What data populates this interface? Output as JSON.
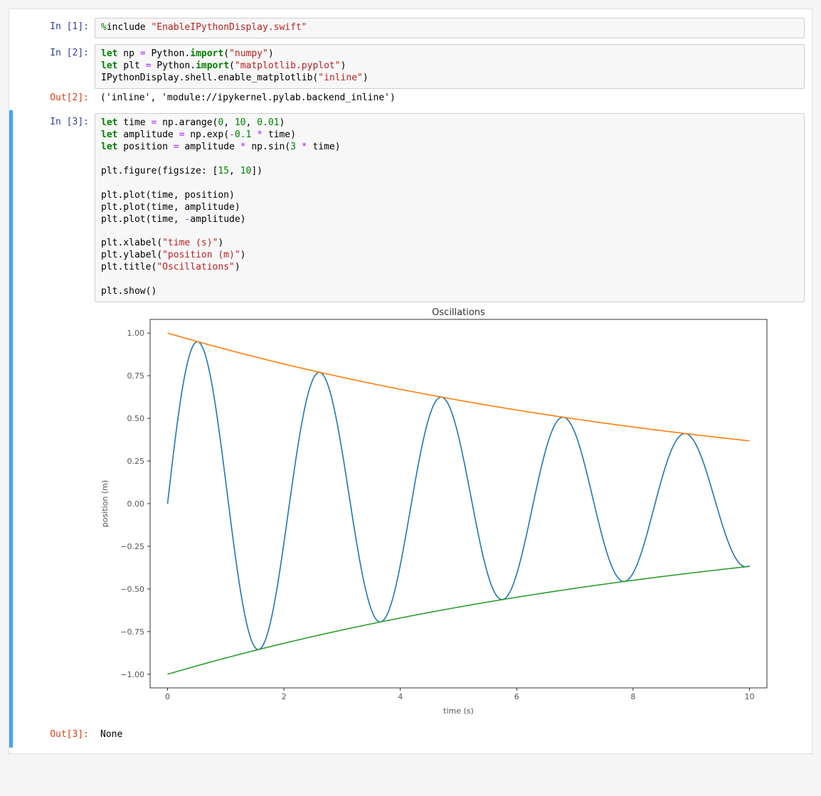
{
  "cells": [
    {
      "in_prompt": "In [1]:",
      "code_tokens": [
        [
          "mg",
          "%"
        ],
        [
          "nm",
          "include "
        ],
        [
          "str",
          "\"EnableIPythonDisplay.swift\""
        ]
      ]
    },
    {
      "in_prompt": "In [2]:",
      "code_tokens": [
        [
          "kw",
          "let"
        ],
        [
          "nm",
          " np "
        ],
        [
          "op",
          "="
        ],
        [
          "nm",
          " Python."
        ],
        [
          "kw",
          "import"
        ],
        [
          "nm",
          "("
        ],
        [
          "str",
          "\"numpy\""
        ],
        [
          "nm",
          ")\n"
        ],
        [
          "kw",
          "let"
        ],
        [
          "nm",
          " plt "
        ],
        [
          "op",
          "="
        ],
        [
          "nm",
          " Python."
        ],
        [
          "kw",
          "import"
        ],
        [
          "nm",
          "("
        ],
        [
          "str",
          "\"matplotlib.pyplot\""
        ],
        [
          "nm",
          ")\n"
        ],
        [
          "nm",
          "IPythonDisplay.shell.enable_matplotlib("
        ],
        [
          "str",
          "\"inline\""
        ],
        [
          "nm",
          ")"
        ]
      ],
      "out_prompt": "Out[2]:",
      "out_text": "('inline', 'module://ipykernel.pylab.backend_inline')"
    },
    {
      "selected": true,
      "in_prompt": "In [3]:",
      "code_tokens": [
        [
          "kw",
          "let"
        ],
        [
          "nm",
          " time "
        ],
        [
          "op",
          "="
        ],
        [
          "nm",
          " np.arange("
        ],
        [
          "num",
          "0"
        ],
        [
          "nm",
          ", "
        ],
        [
          "num",
          "10"
        ],
        [
          "nm",
          ", "
        ],
        [
          "num",
          "0.01"
        ],
        [
          "nm",
          ")\n"
        ],
        [
          "kw",
          "let"
        ],
        [
          "nm",
          " amplitude "
        ],
        [
          "op",
          "="
        ],
        [
          "nm",
          " np.exp("
        ],
        [
          "op",
          "-"
        ],
        [
          "num",
          "0.1"
        ],
        [
          "nm",
          " "
        ],
        [
          "op",
          "*"
        ],
        [
          "nm",
          " time)\n"
        ],
        [
          "kw",
          "let"
        ],
        [
          "nm",
          " position "
        ],
        [
          "op",
          "="
        ],
        [
          "nm",
          " amplitude "
        ],
        [
          "op",
          "*"
        ],
        [
          "nm",
          " np.sin("
        ],
        [
          "num",
          "3"
        ],
        [
          "nm",
          " "
        ],
        [
          "op",
          "*"
        ],
        [
          "nm",
          " time)\n"
        ],
        [
          "nm",
          "\nplt.figure(figsize: ["
        ],
        [
          "num",
          "15"
        ],
        [
          "nm",
          ", "
        ],
        [
          "num",
          "10"
        ],
        [
          "nm",
          "])\n"
        ],
        [
          "nm",
          "\nplt.plot(time, position)\n"
        ],
        [
          "nm",
          "plt.plot(time, amplitude)\n"
        ],
        [
          "nm",
          "plt.plot(time, "
        ],
        [
          "op",
          "-"
        ],
        [
          "nm",
          "amplitude)\n"
        ],
        [
          "nm",
          "\nplt.xlabel("
        ],
        [
          "str",
          "\"time (s)\""
        ],
        [
          "nm",
          ")\n"
        ],
        [
          "nm",
          "plt.ylabel("
        ],
        [
          "str",
          "\"position (m)\""
        ],
        [
          "nm",
          ")\n"
        ],
        [
          "nm",
          "plt.title("
        ],
        [
          "str",
          "\"Oscillations\""
        ],
        [
          "nm",
          ")\n"
        ],
        [
          "nm",
          "\nplt.show()"
        ]
      ],
      "out_prompt": "Out[3]:",
      "out_text": "None"
    }
  ],
  "chart_data": {
    "type": "line",
    "title": "Oscillations",
    "xlabel": "time (s)",
    "ylabel": "position (m)",
    "xlim": [
      0,
      10
    ],
    "ylim": [
      -1.0,
      1.0
    ],
    "xticks": [
      0,
      2,
      4,
      6,
      8,
      10
    ],
    "yticks": [
      -1.0,
      -0.75,
      -0.5,
      -0.25,
      0.0,
      0.25,
      0.5,
      0.75,
      1.0
    ],
    "series": [
      {
        "name": "position",
        "color": "#1f77b4",
        "formula": "exp(-0.1*t)*sin(3*t)"
      },
      {
        "name": "amplitude",
        "color": "#ff7f0e",
        "formula": "exp(-0.1*t)"
      },
      {
        "name": "-amplitude",
        "color": "#2ca02c",
        "formula": "-exp(-0.1*t)"
      }
    ],
    "dt": 0.01,
    "sample_points": {
      "t": [
        0.0,
        1.0,
        2.0,
        3.0,
        4.0,
        5.0,
        6.0,
        7.0,
        8.0,
        9.0,
        10.0
      ],
      "amplitude": [
        1.0,
        0.905,
        0.819,
        0.741,
        0.67,
        0.607,
        0.549,
        0.497,
        0.449,
        0.407,
        0.368
      ],
      "position": [
        0.0,
        0.128,
        -0.229,
        0.305,
        -0.36,
        0.394,
        -0.412,
        0.415,
        -0.406,
        0.388,
        -0.364
      ],
      "neg_amplitude": [
        -1.0,
        -0.905,
        -0.819,
        -0.741,
        -0.67,
        -0.607,
        -0.549,
        -0.497,
        -0.449,
        -0.407,
        -0.368
      ]
    }
  }
}
